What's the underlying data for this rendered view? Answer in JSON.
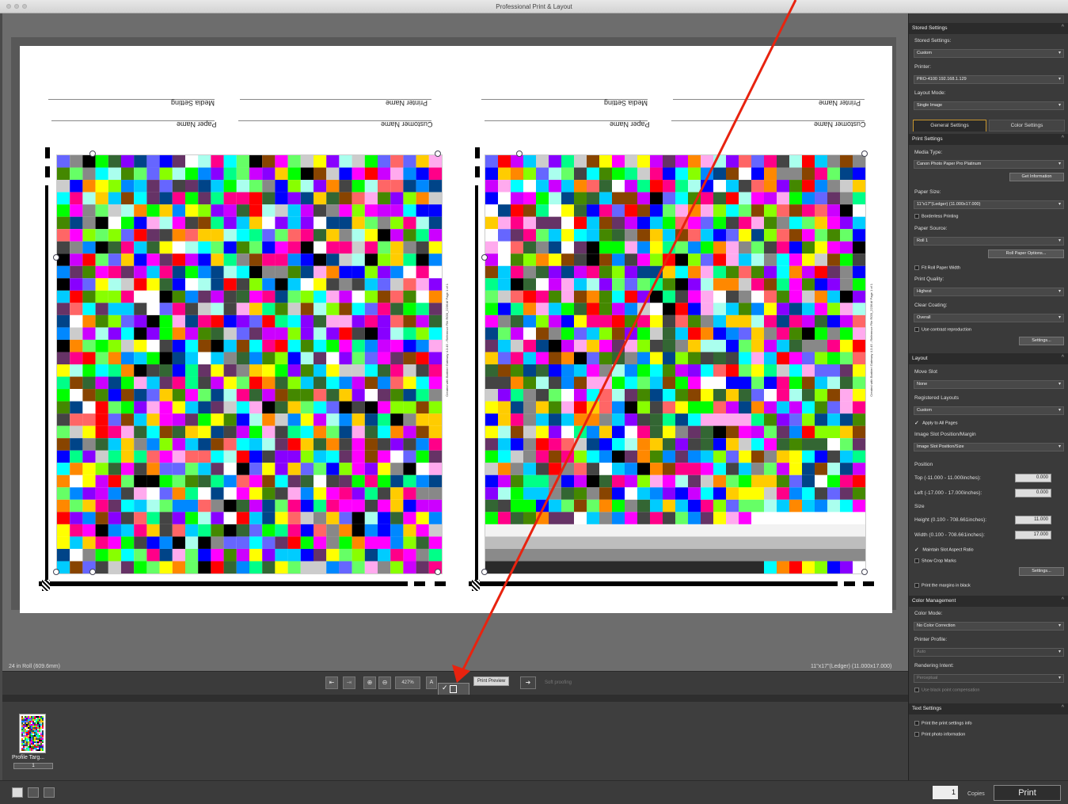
{
  "window": {
    "title": "Professional Print & Layout"
  },
  "page": {
    "headers": {
      "media_setting": "Media Setting",
      "printer_name": "Printer Name",
      "paper_name": "Paper Name",
      "customer_name": "Customer Name"
    },
    "side_text": "Created with Barbieri Gateway 4.3.45 - Reference File RGB_2236.tif Page 1 of 1"
  },
  "canvas_info": {
    "roll": "24 in Roll (609.6mm)",
    "paper_size": "11\"x17\"(Ledger) (11.000x17.000)"
  },
  "toolbar": {
    "zoom": "427%",
    "print_preview": "Print Preview",
    "soft_proofing": "Soft proofing"
  },
  "thumbnail": {
    "label": "Profile Targ...",
    "page": "1"
  },
  "bottom": {
    "copies_value": "1",
    "copies_label": "Copies",
    "print": "Print"
  },
  "sidebar": {
    "stored_section": "Stored Settings",
    "stored_label": "Stored Settings:",
    "stored_value": "Custom",
    "printer_label": "Printer:",
    "printer_value": "PRO-4100 192.168.1.129",
    "layout_mode_label": "Layout Mode:",
    "layout_mode_value": "Single Image",
    "tab_general": "General Settings",
    "tab_color": "Color Settings",
    "print_settings_section": "Print Settings",
    "media_type_label": "Media Type:",
    "media_type_value": "Canon Photo Paper Pro Platinum",
    "get_information": "Get Information",
    "paper_size_label": "Paper Size:",
    "paper_size_value": "11\"x17\"(Ledger) (11.000x17.000)",
    "borderless": "Borderless Printing",
    "paper_source_label": "Paper Source:",
    "paper_source_value": "Roll 1",
    "roll_options": "Roll Paper Options...",
    "fit_roll": "Fit Roll Paper Width",
    "print_quality_label": "Print Quality:",
    "print_quality_value": "Highest",
    "clear_coating_label": "Clear Coating:",
    "clear_coating_value": "Overall",
    "contrast": "Use contrast reproduction",
    "settings_btn": "Settings...",
    "layout_section": "Layout",
    "move_slot_label": "Move Slot",
    "move_slot_value": "None",
    "registered_label": "Registered Layouts",
    "registered_value": "Custom",
    "apply_all": "Apply to All Pages",
    "slot_pos_label": "Image Slot Position/Margin",
    "slot_pos_value": "Image Slot Position/Size",
    "position_label": "Position",
    "top_label": "Top (-11.000 - 11.000inches):",
    "top_value": "0.000",
    "left_label": "Left (-17.000 - 17.000inches):",
    "left_value": "0.000",
    "size_label": "Size",
    "height_label": "Height (0.100 - 708.661inches):",
    "height_value": "11.000",
    "width_label": "Width (0.100 - 708.661inches):",
    "width_value": "17.000",
    "aspect": "Maintain Slot Aspect Ratio",
    "crop_marks": "Show Crop Marks",
    "settings_btn2": "Settings...",
    "margins_black": "Print the margins in black",
    "color_section": "Color Management",
    "color_mode_label": "Color Mode:",
    "color_mode_value": "No Color Correction",
    "printer_profile_label": "Printer Profile:",
    "printer_profile_value": "Auto",
    "rendering_label": "Rendering Intent:",
    "rendering_value": "Perceptual",
    "bpc": "Use black point compensation",
    "text_section": "Text Settings",
    "print_settings_info": "Print the print settings info",
    "print_photo_info": "Print photo information"
  },
  "colors": {
    "annotation_arrow": "#e8230f",
    "tab_accent": "#c8962e"
  }
}
